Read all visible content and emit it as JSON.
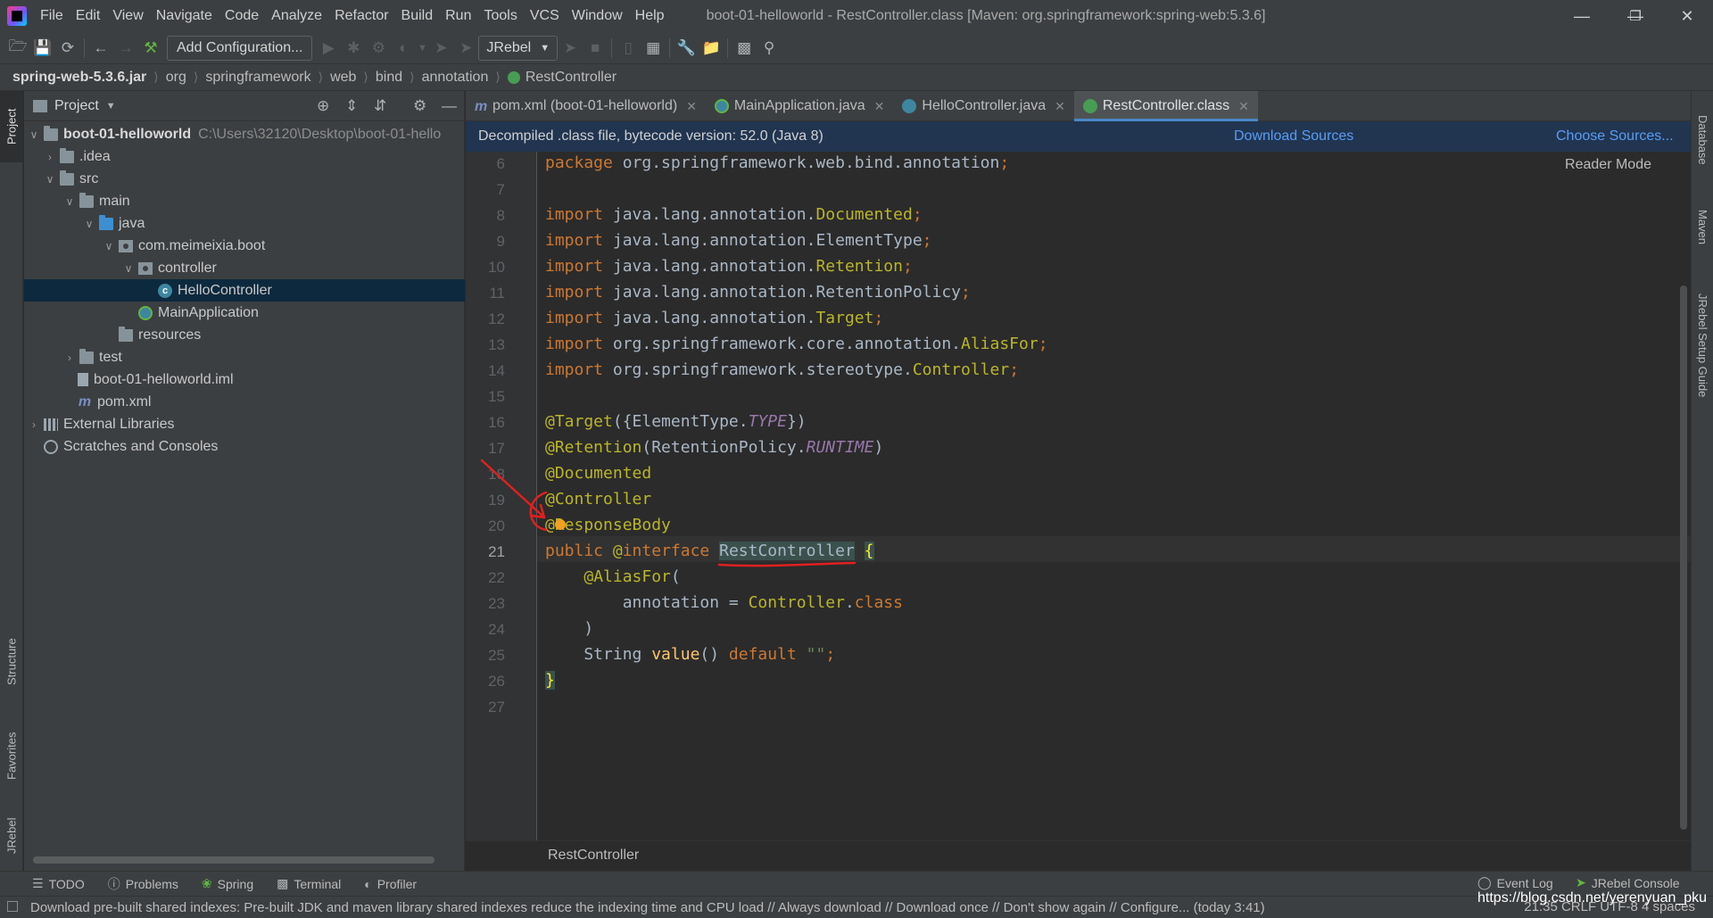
{
  "menu": {
    "items": [
      "File",
      "Edit",
      "View",
      "Navigate",
      "Code",
      "Analyze",
      "Refactor",
      "Build",
      "Run",
      "Tools",
      "VCS",
      "Window",
      "Help"
    ],
    "window_title": "boot-01-helloworld - RestController.class [Maven: org.springframework:spring-web:5.3.6]"
  },
  "toolbar": {
    "add_configuration": "Add Configuration...",
    "jrebel_select": "JRebel"
  },
  "breadcrumb": [
    "spring-web-5.3.6.jar",
    "org",
    "springframework",
    "web",
    "bind",
    "annotation",
    "RestController"
  ],
  "left_tabs": {
    "project": "Project",
    "structure": "Structure",
    "favorites": "Favorites",
    "jrebel": "JRebel"
  },
  "right_tabs": {
    "database": "Database",
    "maven": "Maven",
    "jrebel_guide": "JRebel Setup Guide"
  },
  "project_panel": {
    "title": "Project",
    "tree": [
      {
        "label": "boot-01-helloworld",
        "extra": "C:\\Users\\32120\\Desktop\\boot-01-hello"
      },
      {
        "label": ".idea"
      },
      {
        "label": "src"
      },
      {
        "label": "main"
      },
      {
        "label": "java"
      },
      {
        "label": "com.meimeixia.boot"
      },
      {
        "label": "controller"
      },
      {
        "label": "HelloController"
      },
      {
        "label": "MainApplication"
      },
      {
        "label": "resources"
      },
      {
        "label": "test"
      },
      {
        "label": "boot-01-helloworld.iml"
      },
      {
        "label": "pom.xml"
      },
      {
        "label": "External Libraries"
      },
      {
        "label": "Scratches and Consoles"
      }
    ]
  },
  "tabs": [
    {
      "label": "pom.xml (boot-01-helloworld)"
    },
    {
      "label": "MainApplication.java"
    },
    {
      "label": "HelloController.java"
    },
    {
      "label": "RestController.class"
    }
  ],
  "banner": {
    "message": "Decompiled .class file, bytecode version: 52.0 (Java 8)",
    "download_sources": "Download Sources",
    "choose_sources": "Choose Sources..."
  },
  "editor": {
    "reader_mode": "Reader Mode",
    "line_numbers": [
      "6",
      "7",
      "8",
      "9",
      "10",
      "11",
      "12",
      "13",
      "14",
      "15",
      "16",
      "17",
      "18",
      "19",
      "20",
      "21",
      "22",
      "23",
      "24",
      "25",
      "26",
      "27"
    ],
    "current_line": "21",
    "bottom_crumb": "RestController"
  },
  "bottom_tools": [
    "TODO",
    "Problems",
    "Spring",
    "Terminal",
    "Profiler",
    "Event Log",
    "JRebel Console"
  ],
  "status": {
    "message": "Download pre-built shared indexes: Pre-built JDK and maven library shared indexes reduce the indexing time and CPU load // Always download // Download once // Don't show again // Configure... (today 3:41)",
    "right": "21:35   CRLF   UTF-8   4 spaces",
    "watermark": "https://blog.csdn.net/yerenyuan_pku"
  },
  "colors": {
    "accent": "#4a88c7",
    "banner": "#213551",
    "annotation": "#e02020"
  }
}
